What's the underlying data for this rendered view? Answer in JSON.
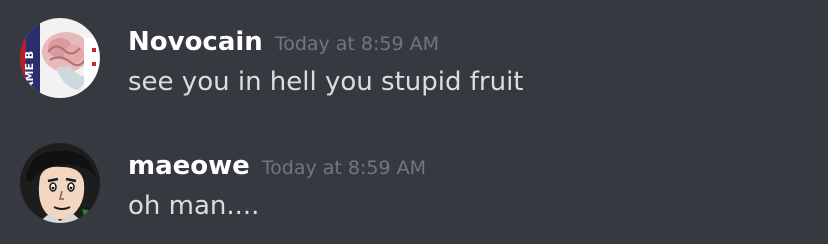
{
  "messages": [
    {
      "username": "Novocain",
      "timestamp": "Today at 8:59 AM",
      "text": "see you in hell you stupid fruit",
      "avatar_icon": "brain-game-cover-avatar",
      "avatar_text": "AME B"
    },
    {
      "username": "maeowe",
      "timestamp": "Today at 8:59 AM",
      "text": "oh man....",
      "avatar_icon": "cartoon-face-avatar"
    }
  ],
  "colors": {
    "background": "#36393f",
    "username": "#ffffff",
    "timestamp": "#72767d",
    "text": "#dcddde"
  }
}
